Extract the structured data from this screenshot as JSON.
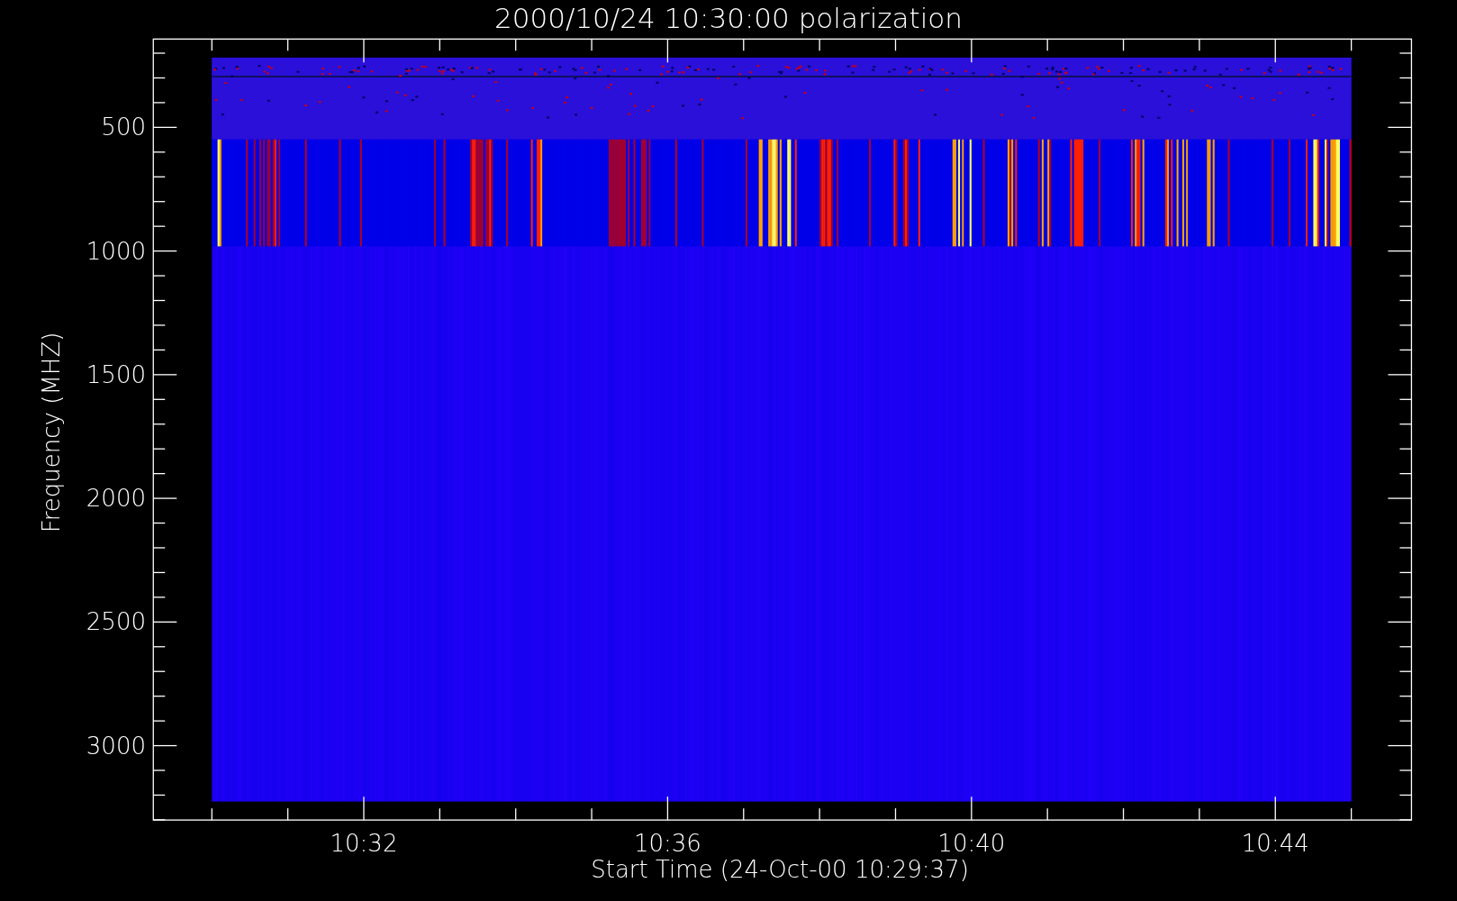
{
  "plot": {
    "title": "2000/10/24 10:30:00 polarization",
    "xlabel": "Start Time (24-Oct-00 10:29:37)",
    "ylabel": "Frequency (MHZ)",
    "xtick_labels": [
      "10:32",
      "10:36",
      "10:40",
      "10:44"
    ],
    "ytick_labels": [
      "500",
      "1000",
      "1500",
      "2000",
      "2500",
      "3000"
    ]
  }
}
